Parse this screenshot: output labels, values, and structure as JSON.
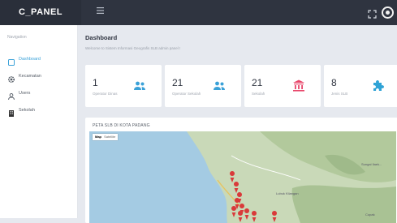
{
  "topbar": {
    "brand": "C_PANEL",
    "menu_icon": "hamburger-icon",
    "fullscreen_icon": "expand-icon",
    "user_icon": "user-avatar-icon"
  },
  "sidebar": {
    "header": "Navigation",
    "items": [
      {
        "label": "Dashboard",
        "icon": "dashboard-icon",
        "active": true
      },
      {
        "label": "Kecamatan",
        "icon": "gear-icon"
      },
      {
        "label": "Users",
        "icon": "user-icon"
      },
      {
        "label": "Sekolah",
        "icon": "building-icon"
      }
    ]
  },
  "main": {
    "title": "Dashboard",
    "subtitle": "Welcome to Sistem Informasi Geografis SLB admin panel !",
    "cards": [
      {
        "value": "1",
        "caption": "Operator Dinas",
        "icon": "users-icon",
        "color": "#3aa1d8"
      },
      {
        "value": "21",
        "caption": "Operator Sekolah",
        "icon": "users-icon",
        "color": "#3aa1d8"
      },
      {
        "value": "21",
        "caption": "Sekolah",
        "icon": "institution-icon",
        "color": "#e8466a"
      },
      {
        "value": "8",
        "caption": "Jenis SLB",
        "icon": "puzzle-icon",
        "color": "#2fa3d6"
      }
    ],
    "map": {
      "title": "PETA SLB DI KOTA PADANG",
      "toggle_map": "Map",
      "toggle_sat": "Satellite",
      "labels": [
        "Sungai Ilaek...",
        "Lubuk Kilangan",
        "Cupak"
      ]
    }
  }
}
